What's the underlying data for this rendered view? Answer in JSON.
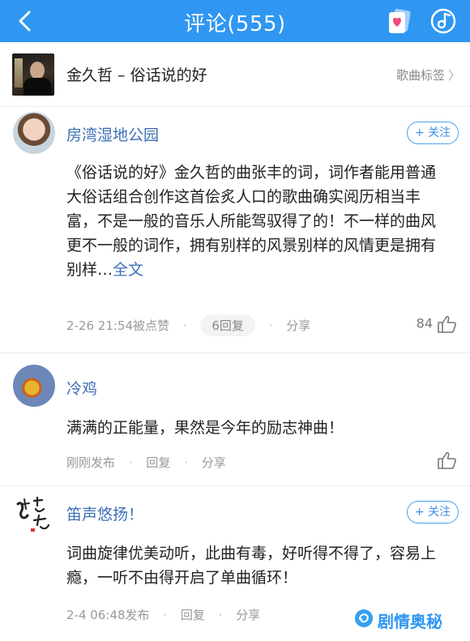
{
  "header": {
    "title": "评论(555)",
    "accent_color": "#2f97f2",
    "back_icon": "back-arrow-icon",
    "right_icons": [
      "heart-card-icon",
      "music-note-icon"
    ]
  },
  "song": {
    "title": "金久哲 – 俗话说的好",
    "tag_link": "歌曲标签",
    "cover_icon": "album-cover"
  },
  "comments": [
    {
      "username": "房湾湿地公园",
      "follow_label": "+ 关注",
      "text": "《俗话说的好》金久哲的曲张丰的词，词作者能用普通大俗话组合创作这首侩炙人口的歌曲确实阅历相当丰富，不是一般的音乐人所能驾驭得了的！不一样的曲风更不一般的词作，拥有别样的风景别样的风情更是拥有别样…",
      "more_label": "全文",
      "time": "2-26 21:54被点赞",
      "reply": "6回复",
      "share": "分享",
      "likes": "84"
    },
    {
      "username": "冷鸡",
      "text": "满满的正能量，果然是今年的励志神曲！",
      "time": "刚刚发布",
      "reply": "回复",
      "share": "分享",
      "likes": ""
    },
    {
      "username": "笛声悠扬！",
      "follow_label": "+ 关注",
      "text": "词曲旋律优美动听，此曲有毒，好听得不得了，容易上瘾，一听不由得开启了单曲循环！",
      "time": "2-4 06:48发布",
      "reply": "回复",
      "share": "分享"
    }
  ],
  "watermark": {
    "text": "剧情奥秘"
  }
}
